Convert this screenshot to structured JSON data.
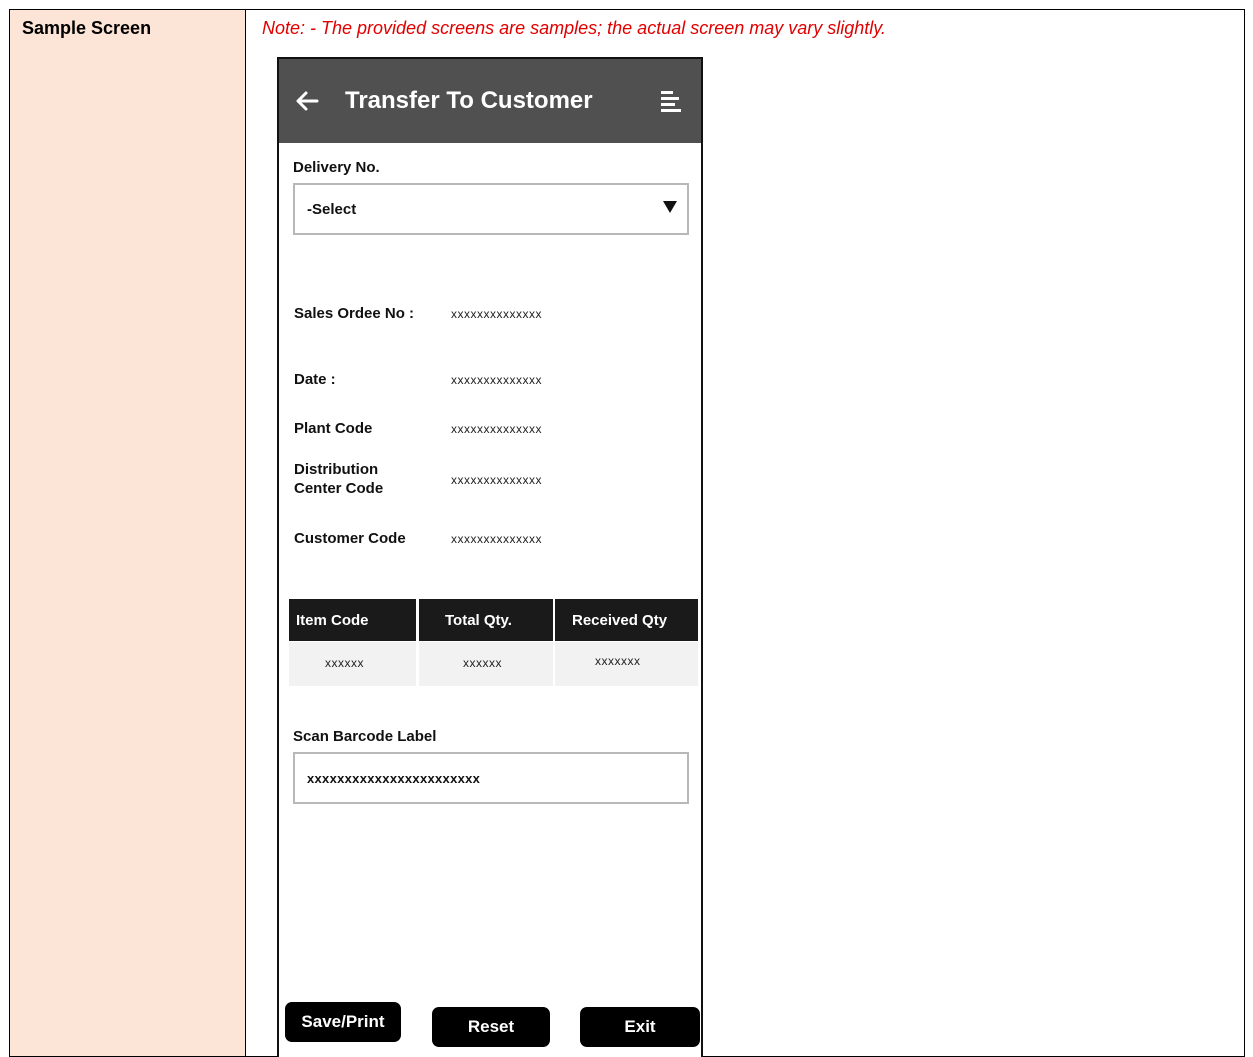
{
  "document": {
    "left_label": "Sample Screen",
    "note": "Note: - The provided screens are samples; the actual screen may vary slightly."
  },
  "app": {
    "title": "Transfer To Customer",
    "icons": {
      "back": "arrow-left-icon",
      "menu": "menu-lines-icon",
      "dropdown": "caret-down-icon"
    },
    "delivery": {
      "label": "Delivery No.",
      "selected": "-Select"
    },
    "fields": [
      {
        "label": "Sales Ordee No :",
        "value": "xxxxxxxxxxxxxx"
      },
      {
        "label": "Date :",
        "value": "xxxxxxxxxxxxxx"
      },
      {
        "label": "Plant Code",
        "value": "xxxxxxxxxxxxxx"
      },
      {
        "label": "Distribution Center Code",
        "value": "xxxxxxxxxxxxxx"
      },
      {
        "label": "Customer Code",
        "value": "xxxxxxxxxxxxxx"
      }
    ],
    "table": {
      "headers": [
        "Item Code",
        "Total Qty.",
        "Received Qty"
      ],
      "rows": [
        [
          "xxxxxx",
          "xxxxxx",
          "xxxxxxx"
        ]
      ]
    },
    "barcode": {
      "label": "Scan Barcode Label",
      "value": "xxxxxxxxxxxxxxxxxxxxxxx"
    },
    "buttons": {
      "save": "Save/Print",
      "reset": "Reset",
      "exit": "Exit"
    },
    "colors": {
      "appbar": "#505050",
      "table_header": "#1a1a1a",
      "button": "#000000",
      "note": "#e00000",
      "left_column": "#fce4d6"
    }
  }
}
